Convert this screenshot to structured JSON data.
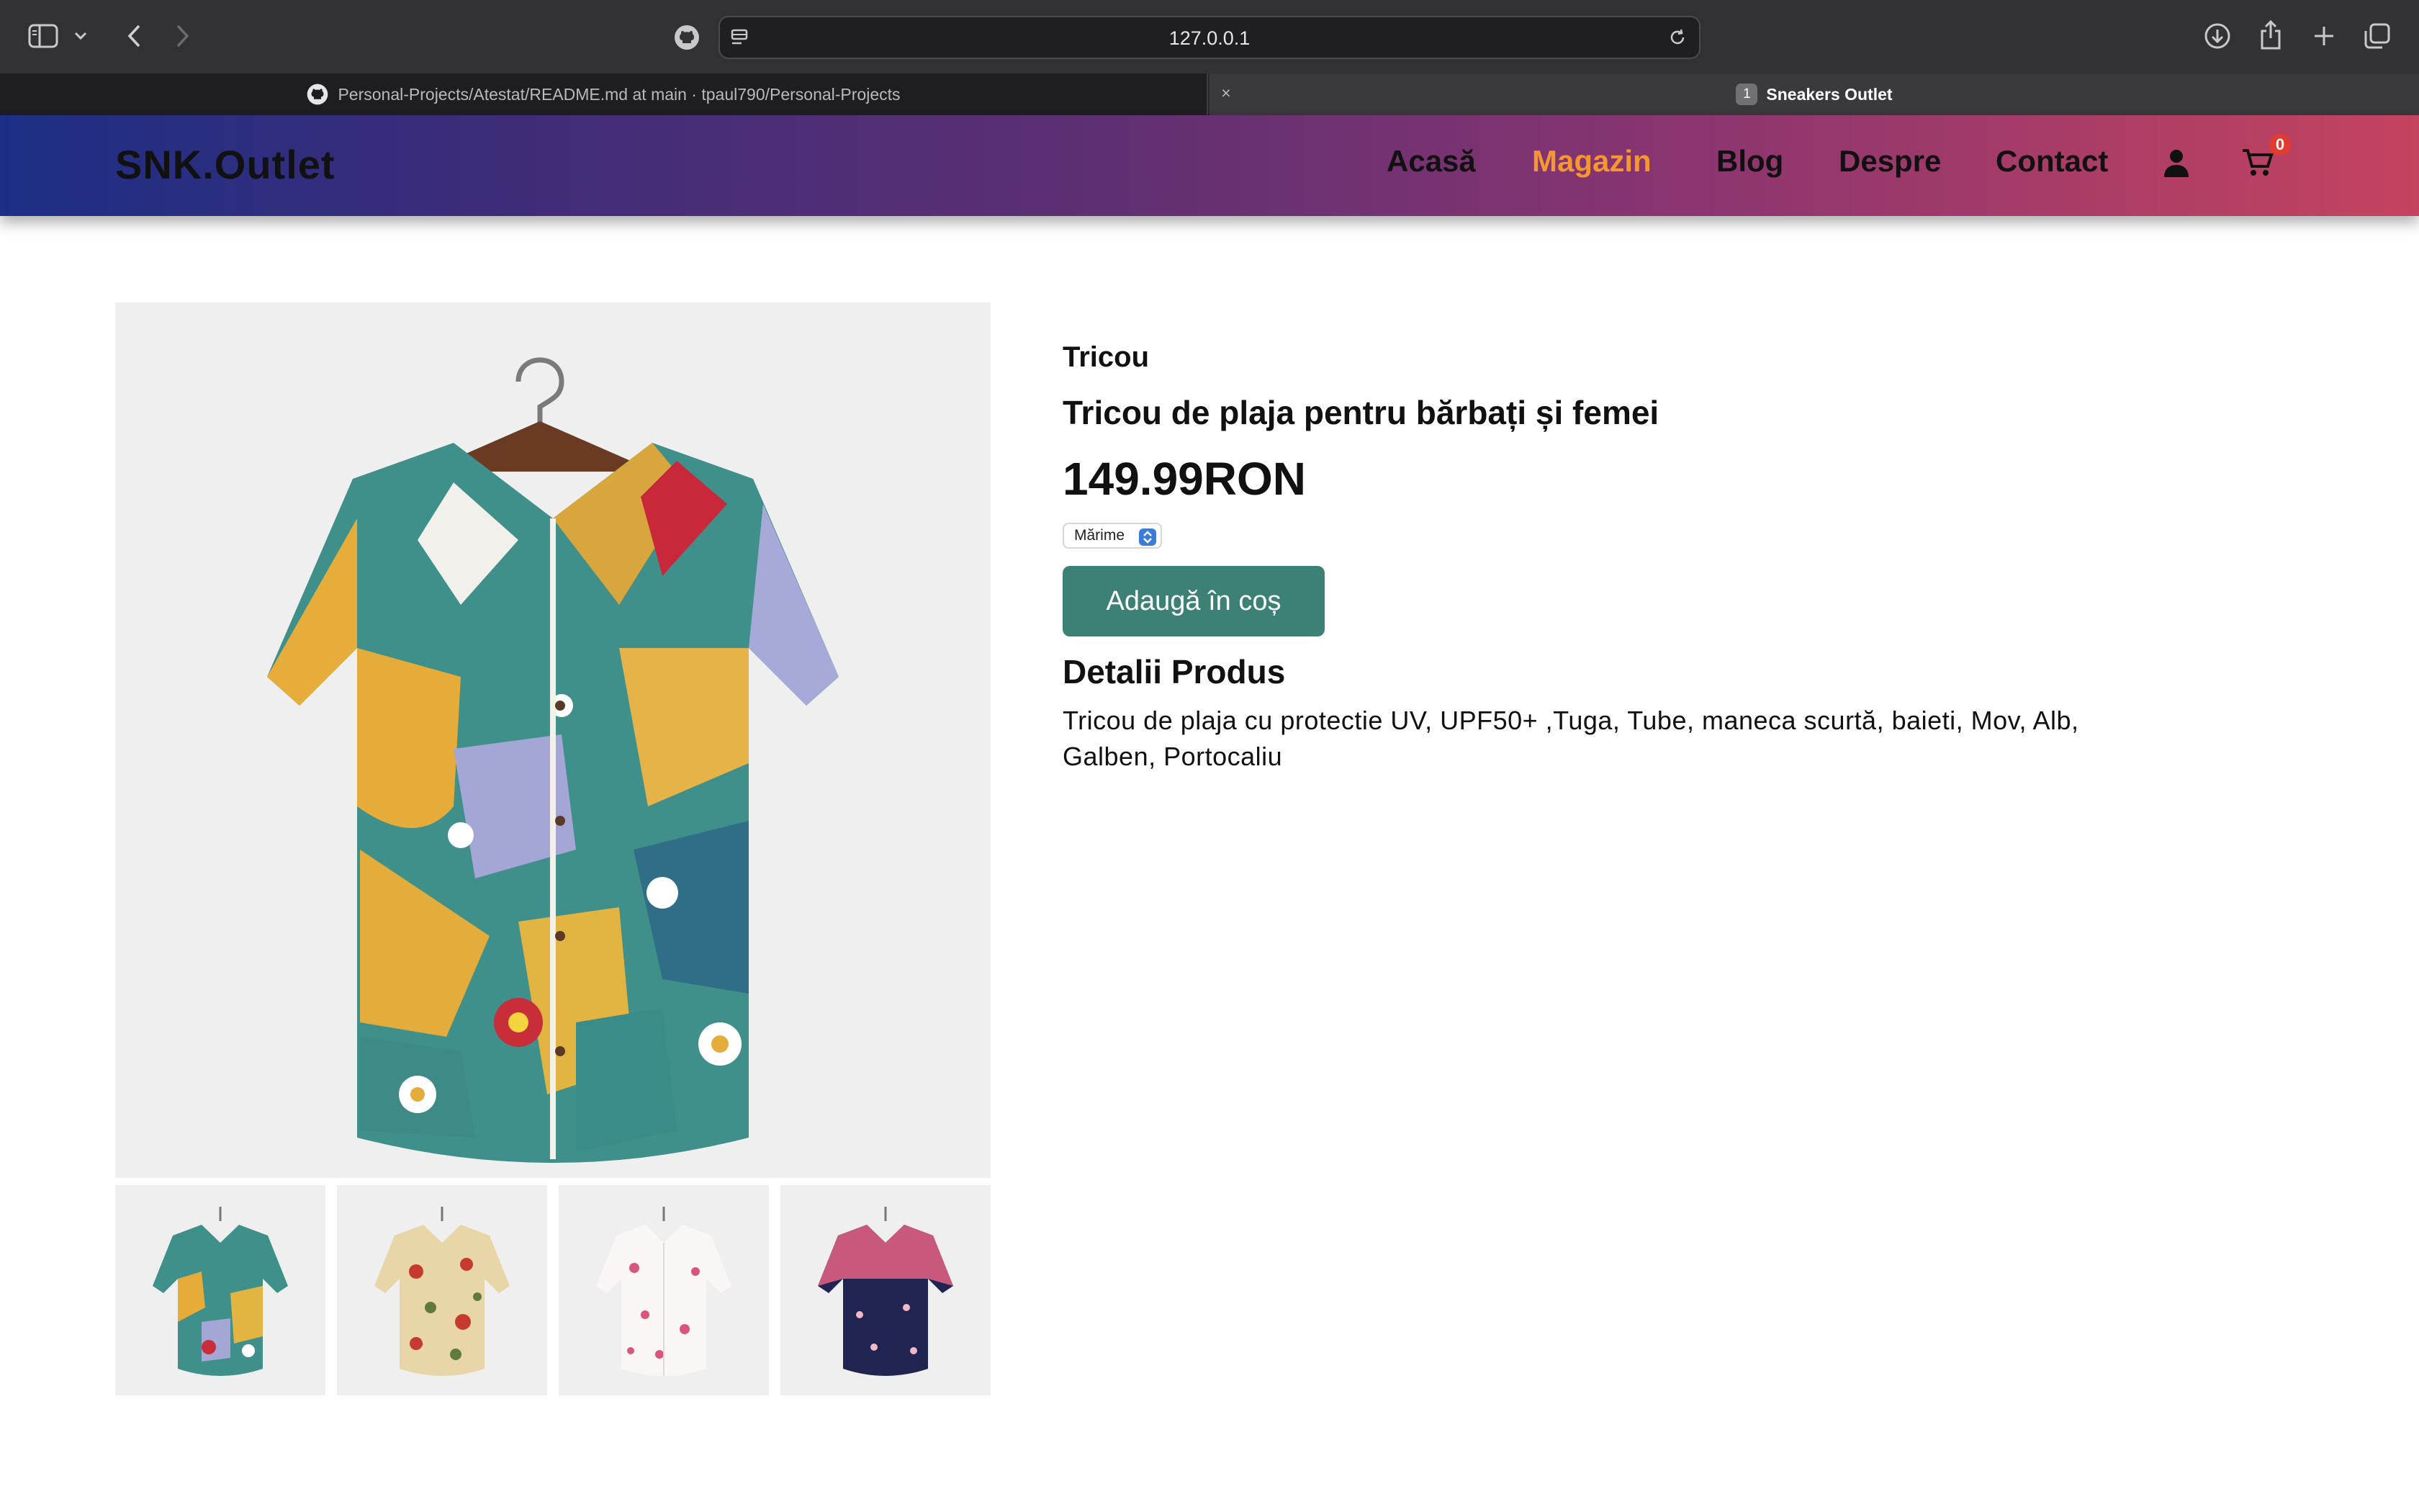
{
  "browser": {
    "url": "127.0.0.1",
    "tabs": [
      {
        "label": "Personal-Projects/Atestat/README.md at main · tpaul790/Personal-Projects"
      },
      {
        "label": "Sneakers Outlet",
        "index": "1"
      }
    ]
  },
  "header": {
    "logo": "SNK.Outlet",
    "nav": [
      "Acasă",
      "Magazin",
      "Blog",
      "Despre",
      "Contact"
    ],
    "active_nav": "Magazin",
    "cart_count": "0",
    "accent_color": "#f5962e"
  },
  "product": {
    "category": "Tricou",
    "title": "Tricou de plaja pentru bărbați și femei",
    "price": "149.99RON",
    "size_select": "Mărime",
    "add_to_cart": "Adaugă în coș",
    "details_heading": "Detalii Produs",
    "details": "Tricou de plaja cu protectie UV, UPF50+ ,Tuga, Tube, maneca scurtă, baieti, Mov, Alb, Galben, Portocaliu",
    "button_color": "#3d8075"
  }
}
